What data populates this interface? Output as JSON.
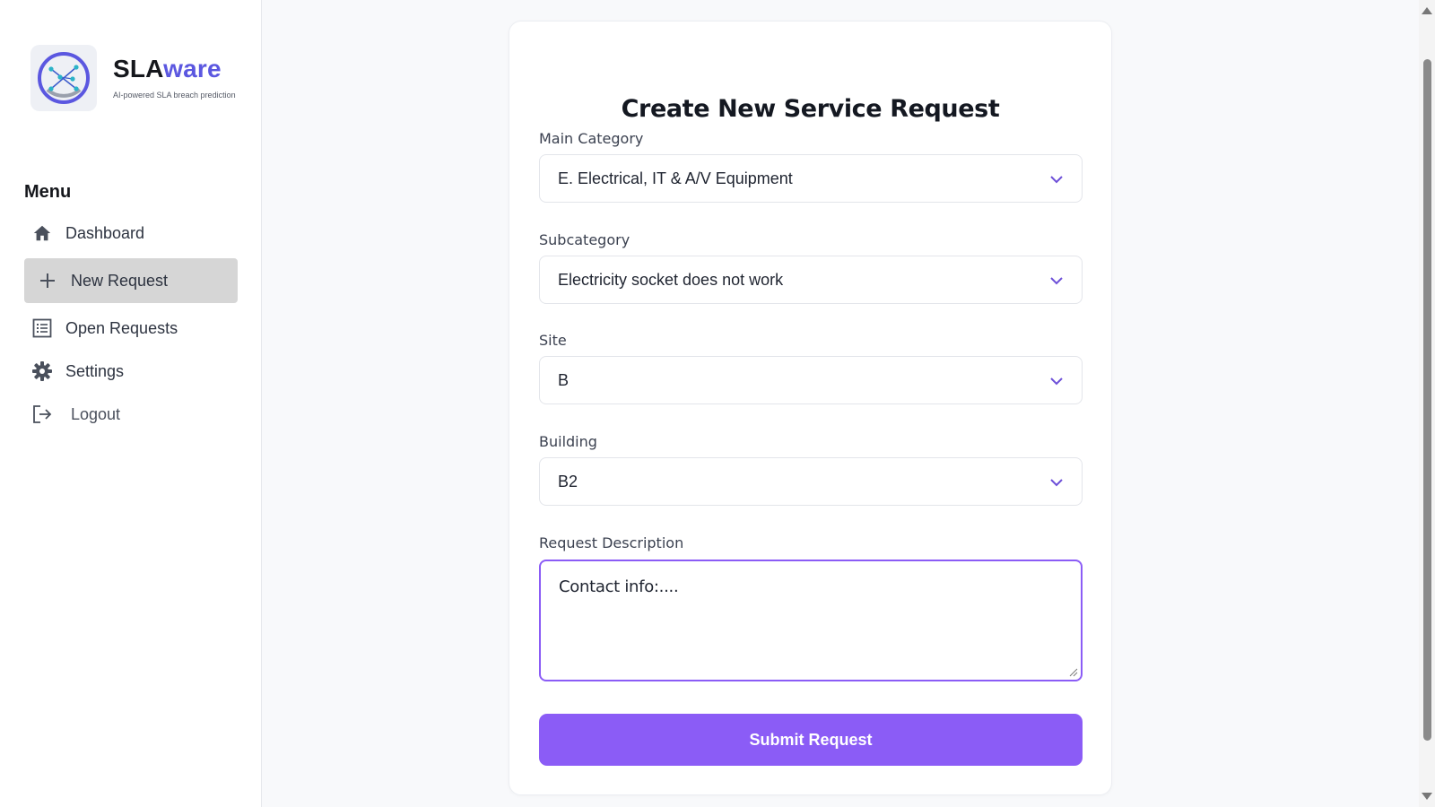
{
  "brand": {
    "name_part1": "SLA",
    "name_part2": "ware",
    "tagline": "AI-powered SLA breach prediction",
    "accent_color": "#5b57e0"
  },
  "sidebar": {
    "menu_title": "Menu",
    "items": [
      {
        "label": "Dashboard",
        "icon": "home-icon",
        "active": false
      },
      {
        "label": "New Request",
        "icon": "plus-icon",
        "active": true
      },
      {
        "label": "Open Requests",
        "icon": "list-icon",
        "active": false
      },
      {
        "label": "Settings",
        "icon": "gear-icon",
        "active": false
      },
      {
        "label": "Logout",
        "icon": "logout-icon",
        "active": false
      }
    ]
  },
  "form": {
    "title": "Create New Service Request",
    "main_category": {
      "label": "Main Category",
      "value": "E. Electrical, IT & A/V Equipment"
    },
    "subcategory": {
      "label": "Subcategory",
      "value": "Electricity socket does not work"
    },
    "site": {
      "label": "Site",
      "value": "B"
    },
    "building": {
      "label": "Building",
      "value": "B2"
    },
    "description": {
      "label": "Request Description",
      "value": "Contact info:...."
    },
    "submit_label": "Submit Request",
    "primary_color": "#8b5cf6"
  }
}
